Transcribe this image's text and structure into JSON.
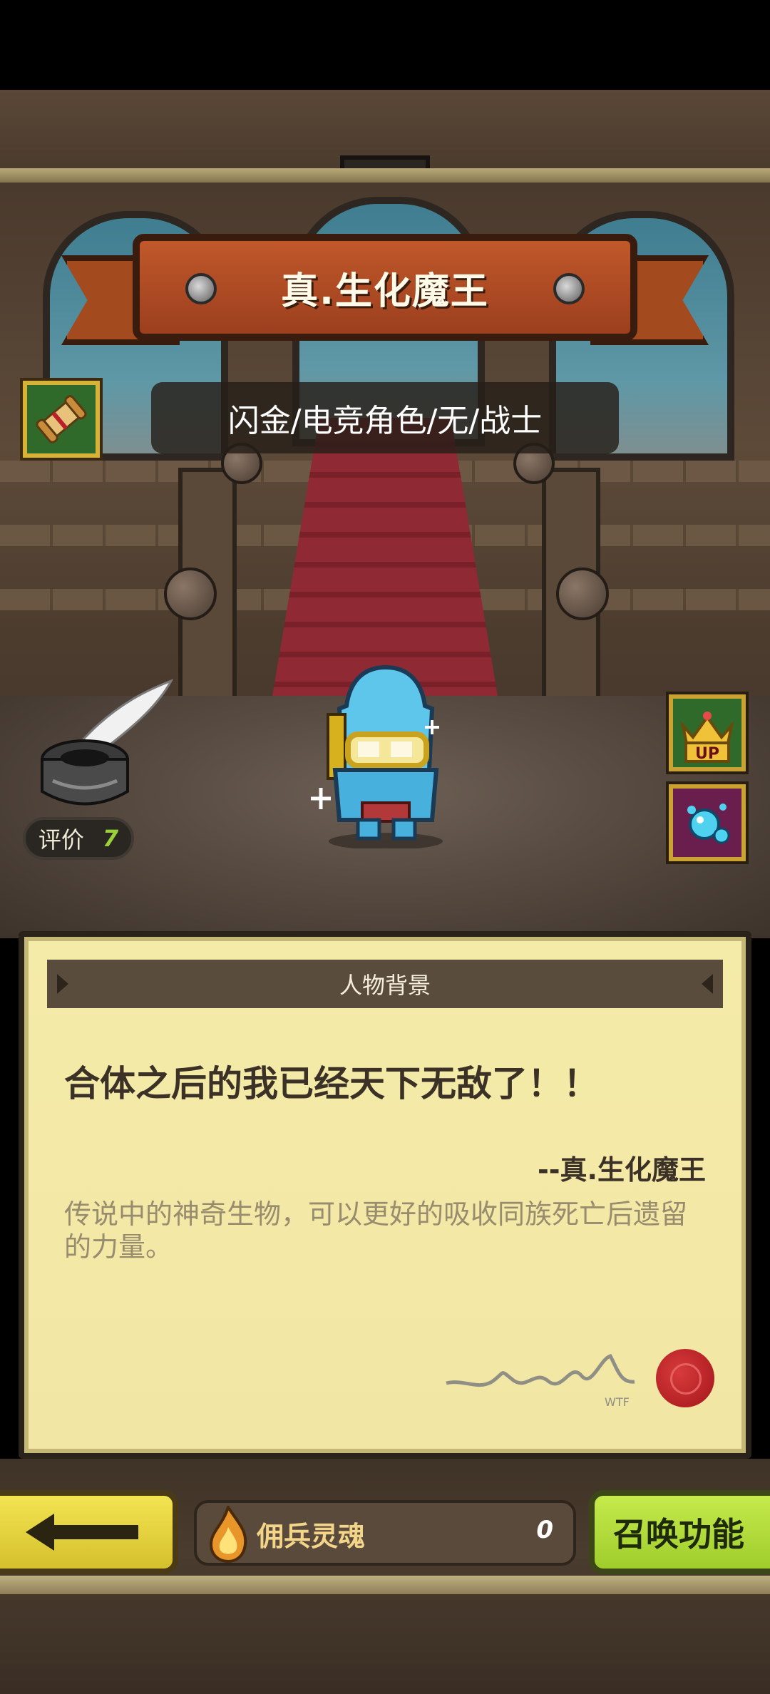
{
  "character": {
    "name": "真.生化魔王",
    "tags": "闪金/电竞角色/无/战士"
  },
  "rating": {
    "label": "评价",
    "value": "7"
  },
  "background_panel": {
    "title": "人物背景",
    "quote": "合体之后的我已经天下无敌了！！",
    "quote_author": "--真.生化魔王",
    "description": "传说中的神奇生物，可以更好的吸收同族死亡后遗留的力量。",
    "signature": "WTF"
  },
  "bottom_bar": {
    "soul_label": "佣兵灵魂",
    "soul_count": "0",
    "summon_label": "召唤功能"
  },
  "icons": {
    "back": "arrow-left-icon",
    "scroll": "scroll-icon",
    "crown_up": "crown-up-icon",
    "blob_skill": "blob-skill-icon",
    "soul": "flame-soul-icon",
    "ink": "inkpot-quill-icon"
  },
  "colors": {
    "banner": "#b04c22",
    "parchment": "#f4e9a8",
    "summon": "#b5de3c",
    "back": "#ead83f",
    "rating_value": "#9ad13a"
  }
}
